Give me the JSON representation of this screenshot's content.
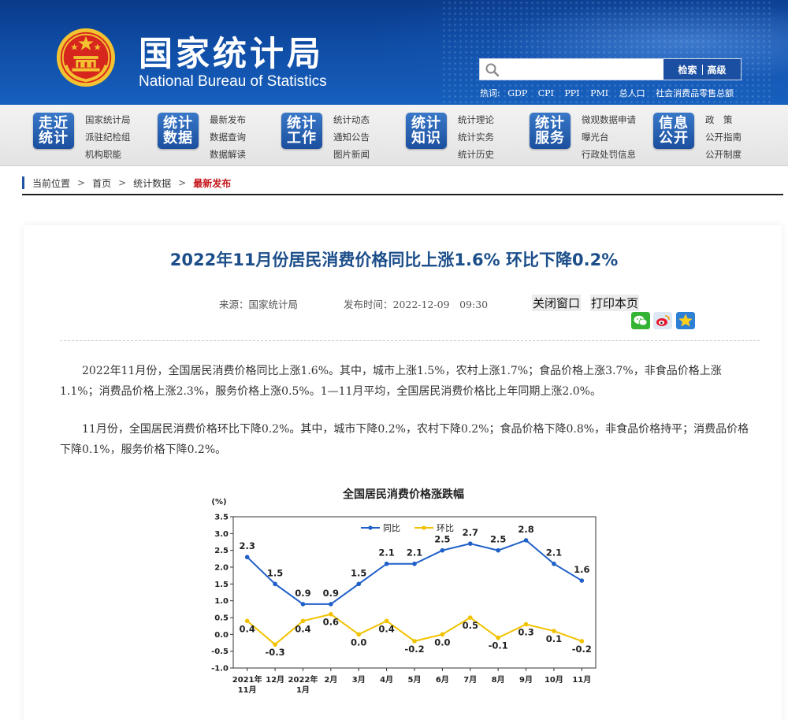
{
  "header": {
    "site_name_cn": "国家统计局",
    "site_name_en": "National Bureau of Statistics",
    "search": {
      "placeholder": "",
      "search_button": "检索",
      "advanced_button": "高级"
    },
    "hotwords_label": "热词:",
    "hotwords": [
      "GDP",
      "CPI",
      "PPI",
      "PMI",
      "总人口",
      "社会消费品零售总额"
    ],
    "colors": {
      "banner": "#0f4da6",
      "accent_red": "#c4161c",
      "emblem_gold": "#f2c230"
    }
  },
  "nav": [
    {
      "tile": [
        "走近",
        "统计"
      ],
      "links": [
        "国家统计局",
        "派驻纪检组",
        "机构职能"
      ]
    },
    {
      "tile": [
        "统计",
        "数据"
      ],
      "links": [
        "最新发布",
        "数据查询",
        "数据解读"
      ]
    },
    {
      "tile": [
        "统计",
        "工作"
      ],
      "links": [
        "统计动态",
        "通知公告",
        "图片新闻"
      ]
    },
    {
      "tile": [
        "统计",
        "知识"
      ],
      "links": [
        "统计理论",
        "统计实务",
        "统计历史"
      ]
    },
    {
      "tile": [
        "统计",
        "服务"
      ],
      "links": [
        "微观数据申请",
        "曝光台",
        "行政处罚信息"
      ]
    },
    {
      "tile": [
        "信息",
        "公开"
      ],
      "links": [
        "政　策",
        "公开指南",
        "公开制度"
      ]
    }
  ],
  "breadcrumb": {
    "label": "当前位置",
    "items": [
      "首页",
      "统计数据"
    ],
    "current": "最新发布",
    "separator": ">"
  },
  "article": {
    "title": "2022年11月份居民消费价格同比上涨1.6% 环比下降0.2%",
    "source": "来源：国家统计局",
    "publish_time": "发布时间：2022-12-09　09:30",
    "close_window": "关闭窗口",
    "print_page": "打印本页",
    "share_icons": [
      "wechat-icon",
      "weibo-icon",
      "qzone-icon"
    ],
    "paragraphs": [
      "2022年11月份，全国居民消费价格同比上涨1.6%。其中，城市上涨1.5%，农村上涨1.7%；食品价格上涨3.7%，非食品价格上涨1.1%；消费品价格上涨2.3%，服务价格上涨0.5%。1—11月平均，全国居民消费价格比上年同期上涨2.0%。",
      "11月份，全国居民消费价格环比下降0.2%。其中，城市下降0.2%，农村下降0.2%；食品价格下降0.8%，非食品价格持平；消费品价格下降0.1%，服务价格下降0.2%。"
    ]
  },
  "chart_data": {
    "type": "line",
    "title": "全国居民消费价格涨跌幅",
    "ylabel": "(%)",
    "xlabel": "",
    "categories": [
      [
        "2021年",
        "11月"
      ],
      [
        "12月"
      ],
      [
        "2022年",
        "1月"
      ],
      [
        "2月"
      ],
      [
        "3月"
      ],
      [
        "4月"
      ],
      [
        "5月"
      ],
      [
        "6月"
      ],
      [
        "7月"
      ],
      [
        "8月"
      ],
      [
        "9月"
      ],
      [
        "10月"
      ],
      [
        "11月"
      ]
    ],
    "ylim": [
      -1.0,
      3.5
    ],
    "yticks": [
      "3.5",
      "3.0",
      "2.5",
      "2.0",
      "1.5",
      "1.0",
      "0.5",
      "0.0",
      "-0.5",
      "-1.0"
    ],
    "grid": false,
    "legend": "top-center",
    "series": [
      {
        "name": "同比",
        "color": "#1f5fc8",
        "values": [
          2.3,
          1.5,
          0.9,
          0.9,
          1.5,
          2.1,
          2.1,
          2.5,
          2.7,
          2.5,
          2.8,
          2.1,
          1.6
        ],
        "labels": [
          "2.3",
          "1.5",
          "0.9",
          "0.9",
          "1.5",
          "2.1",
          "2.1",
          "2.5",
          "2.7",
          "2.5",
          "2.8",
          "2.1",
          "1.6"
        ]
      },
      {
        "name": "环比",
        "color": "#f2c200",
        "values": [
          0.4,
          -0.3,
          0.4,
          0.6,
          0.0,
          0.4,
          -0.2,
          0.0,
          0.5,
          -0.1,
          0.3,
          0.1,
          -0.2
        ],
        "labels": [
          "0.4",
          "-0.3",
          "0.4",
          "0.6",
          "0.0",
          "0.4",
          "-0.2",
          "0.0",
          "0.5",
          "-0.1",
          "0.3",
          "0.1",
          "-0.2"
        ]
      }
    ]
  }
}
